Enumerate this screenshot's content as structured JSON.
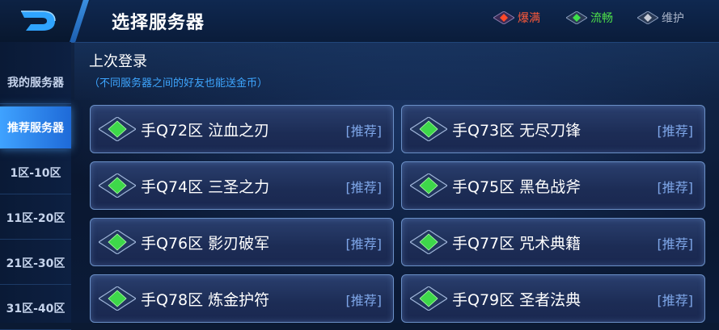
{
  "header": {
    "title": "选择服务器",
    "legend": [
      {
        "label": "爆满",
        "color": "#ff5a3a",
        "icon": "red-gem-icon"
      },
      {
        "label": "流畅",
        "color": "#4ee04a",
        "icon": "green-gem-icon"
      },
      {
        "label": "维护",
        "color": "#a9b4c8",
        "icon": "gray-gem-icon"
      }
    ]
  },
  "sidebar": {
    "items": [
      {
        "label": "我的服务器",
        "active": false
      },
      {
        "label": "推荐服务器",
        "active": true
      },
      {
        "label": "1区-10区",
        "active": false
      },
      {
        "label": "11区-20区",
        "active": false
      },
      {
        "label": "21区-30区",
        "active": false
      },
      {
        "label": "31区-40区",
        "active": false
      }
    ]
  },
  "last_login": {
    "title": "上次登录",
    "note": "（不同服务器之间的好友也能送金币）"
  },
  "servers": [
    {
      "name": "手Q72区 泣血之刃",
      "tag": "[推荐]",
      "status": "流畅"
    },
    {
      "name": "手Q73区 无尽刀锋",
      "tag": "[推荐]",
      "status": "流畅"
    },
    {
      "name": "手Q74区 三圣之力",
      "tag": "[推荐]",
      "status": "流畅"
    },
    {
      "name": "手Q75区 黑色战斧",
      "tag": "[推荐]",
      "status": "流畅"
    },
    {
      "name": "手Q76区 影刃破军",
      "tag": "[推荐]",
      "status": "流畅"
    },
    {
      "name": "手Q77区 咒术典籍",
      "tag": "[推荐]",
      "status": "流畅"
    },
    {
      "name": "手Q78区 炼金护符",
      "tag": "[推荐]",
      "status": "流畅"
    },
    {
      "name": "手Q79区 圣者法典",
      "tag": "[推荐]",
      "status": "流畅"
    }
  ]
}
